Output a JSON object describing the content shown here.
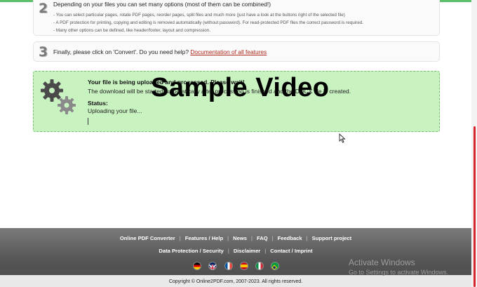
{
  "step2": {
    "number": "2",
    "headline": "Depending on your files you can set many options (most of them can be combined!)",
    "bullets": [
      "- You can select particular pages, rotate PDF pages, reorder pages, split files and much more (just have a look at the buttons right of the selected file)",
      "- A PDF protection for printing, copying and editing is removed automatically (without password). For read-protected PDF files the correct password is required.",
      "- Many other options can be defined, like header/footer, layout and compression."
    ]
  },
  "step3": {
    "number": "3",
    "text": "Finally, please click on 'Convert'. Do you need help?",
    "link": "Documentation of all features"
  },
  "status_panel": {
    "title": "Your file is being uploaded and processed. Please wait!",
    "description": "The download will be started automatically after processing is finished and the DOCX file is created.",
    "status_label": "Status:",
    "status_value": "Uploading your file..."
  },
  "watermark": "Sample Video",
  "footer": {
    "row1": [
      "Online PDF Converter",
      "Features / Help",
      "News",
      "FAQ",
      "Feedback",
      "Support project"
    ],
    "row2": [
      "Data Protection / Security",
      "Disclaimer",
      "Contact / Imprint"
    ],
    "separator": "|",
    "flags": [
      "germany-flag",
      "united-kingdom-flag",
      "france-flag",
      "spain-flag",
      "italy-flag",
      "brazil-flag"
    ],
    "copyright": "Copyright © Online2PDF.com, 2007-2023. All rights reserved."
  },
  "windows_overlay": {
    "title": "Activate Windows",
    "subtitle": "Go to Settings to activate Windows."
  },
  "colors": {
    "accent_green": "#5cbf6a",
    "status_background": "#c9f2c1",
    "link_red": "#b0281e",
    "scrollbar": "#d6242a",
    "footer": "#555555"
  }
}
